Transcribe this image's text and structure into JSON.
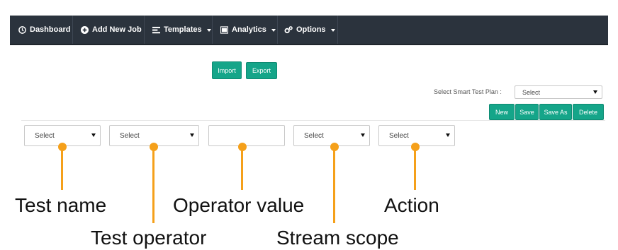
{
  "navbar": {
    "items": [
      {
        "label": "Dashboard",
        "icon": "clock-icon",
        "dropdown": false
      },
      {
        "label": "Add New Job",
        "icon": "plus-circle-icon",
        "dropdown": false
      },
      {
        "label": "Templates",
        "icon": "template-icon",
        "dropdown": true
      },
      {
        "label": "Analytics",
        "icon": "chart-icon",
        "dropdown": true
      },
      {
        "label": "Options",
        "icon": "gears-icon",
        "dropdown": true
      }
    ]
  },
  "toolbar": {
    "import_label": "Import",
    "export_label": "Export"
  },
  "smart_plan": {
    "label": "Select Smart Test Plan :",
    "selected": "Select",
    "buttons": {
      "new": "New",
      "save": "Save",
      "save_as": "Save As",
      "delete": "Delete"
    }
  },
  "filters": {
    "test_name": "Select",
    "test_operator": "Select",
    "operator_value": "",
    "stream_scope": "Select",
    "action": "Select"
  },
  "annotations": {
    "test_name": "Test name",
    "test_operator": "Test operator",
    "operator_value": "Operator value",
    "stream_scope": "Stream scope",
    "action": "Action"
  },
  "colors": {
    "navbar": "#2b333d",
    "accent": "#15a589",
    "annotation": "#f5a01a"
  }
}
